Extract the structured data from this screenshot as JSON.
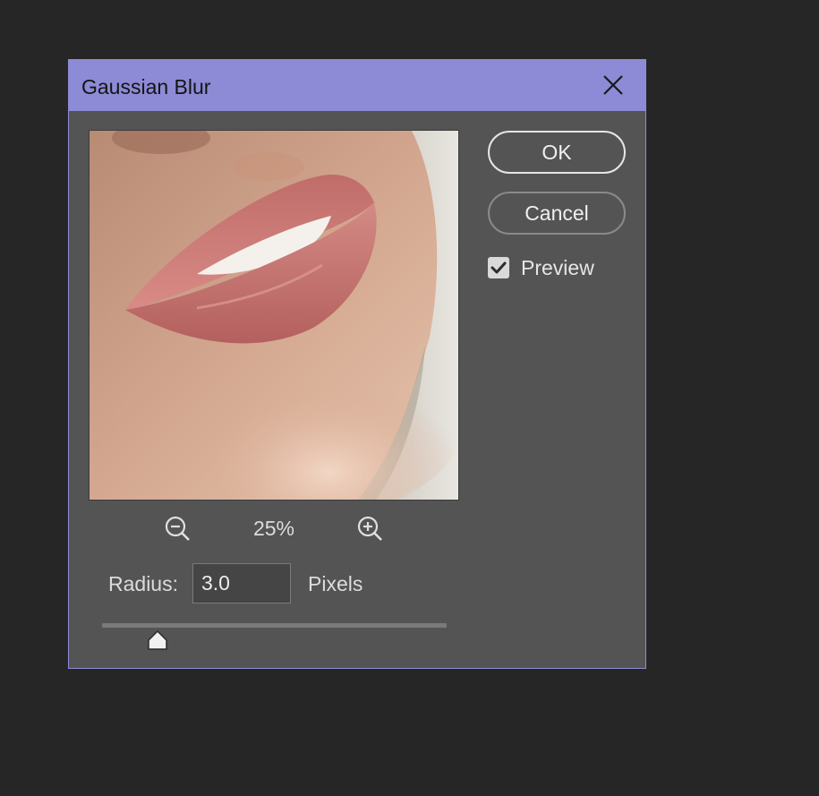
{
  "dialog": {
    "title": "Gaussian Blur",
    "accent_color": "#8d8ad6",
    "close_icon": "close-icon"
  },
  "preview": {
    "image_description_icon": "photo-preview",
    "zoom_level": "25%",
    "zoom_out_icon": "zoom-out-icon",
    "zoom_in_icon": "zoom-in-icon"
  },
  "radius": {
    "label": "Radius:",
    "value": "3.0",
    "units": "Pixels",
    "slider_fraction": 0.16
  },
  "buttons": {
    "ok_label": "OK",
    "cancel_label": "Cancel"
  },
  "preview_option": {
    "label": "Preview",
    "checked": true
  }
}
